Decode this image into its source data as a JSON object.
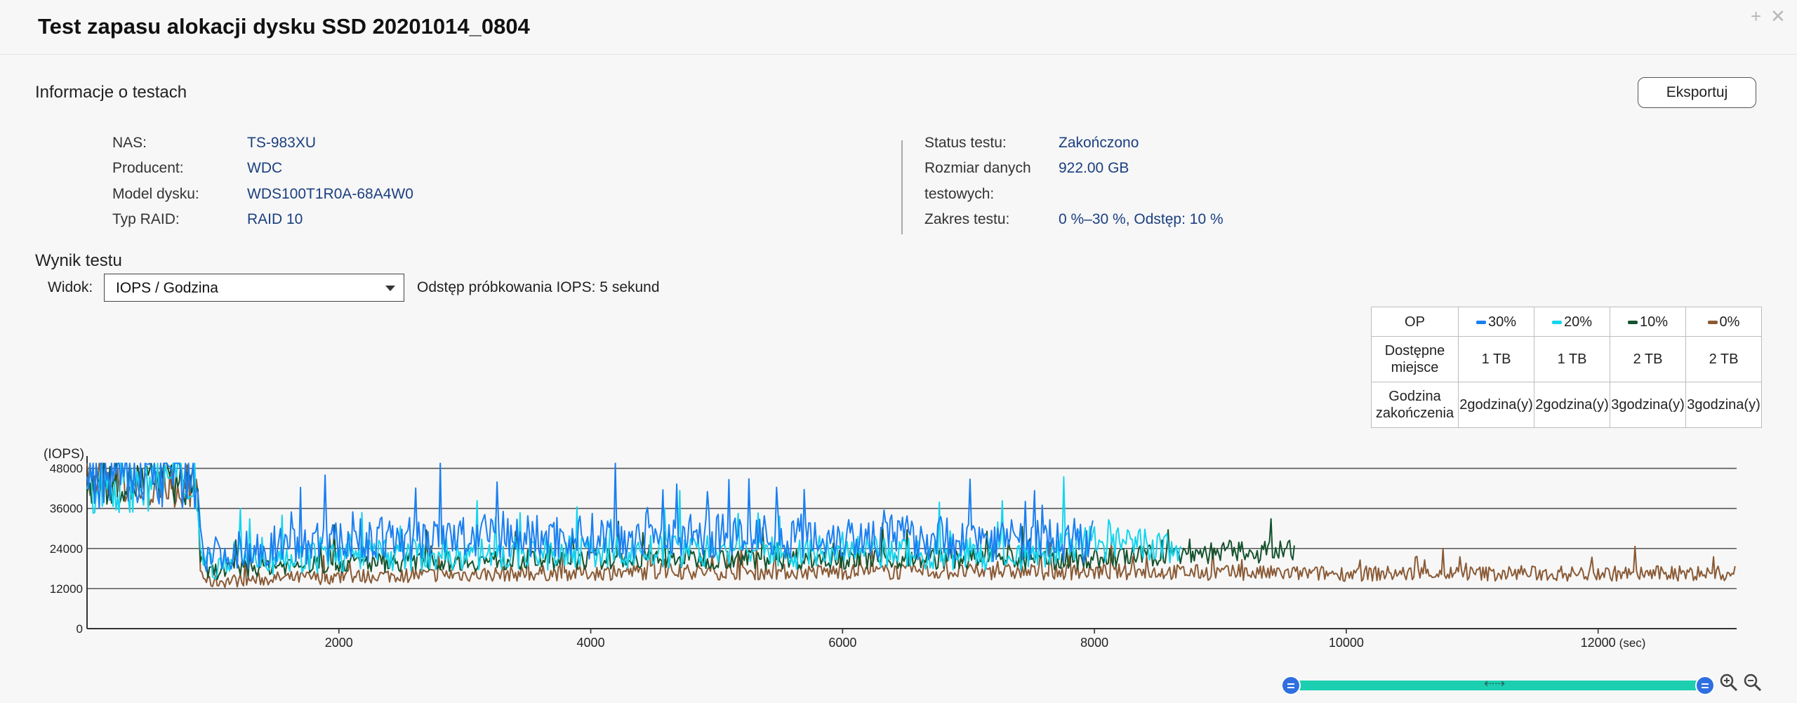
{
  "title": "Test zapasu alokacji dysku SSD 20201014_0804",
  "window_controls": {
    "pin": "+",
    "close": "✕"
  },
  "info_section_title": "Informacje o testach",
  "export_label": "Eksportuj",
  "info_left": [
    {
      "label": "NAS:",
      "value": "TS-983XU"
    },
    {
      "label": "Producent:",
      "value": "WDC"
    },
    {
      "label": "Model dysku:",
      "value": "WDS100T1R0A-68A4W0"
    },
    {
      "label": "Typ RAID:",
      "value": "RAID 10"
    }
  ],
  "info_right": {
    "status_label": "Status testu:",
    "status_value": "Zakończono",
    "size_label_line1": "Rozmiar danych",
    "size_label_line2": "testowych:",
    "size_value": "922.00 GB",
    "range_label": "Zakres testu:",
    "range_value": "0 %–30 %, Odstęp: 10 %"
  },
  "result_section_title": "Wynik testu",
  "view": {
    "label": "Widok:",
    "selected": "IOPS / Godzina"
  },
  "sampling_text": "Odstęp próbkowania IOPS: 5 sekund",
  "op_table": {
    "header": "OP",
    "columns": [
      {
        "label": "30%",
        "color": "#1a7ff0",
        "space": "1 TB",
        "time": "2godzina(y)"
      },
      {
        "label": "20%",
        "color": "#14d4ee",
        "space": "1 TB",
        "time": "2godzina(y)"
      },
      {
        "label": "10%",
        "color": "#14532d",
        "space": "2 TB",
        "time": "3godzina(y)"
      },
      {
        "label": "0%",
        "color": "#8a5a35",
        "space": "2 TB",
        "time": "3godzina(y)"
      }
    ],
    "row_space_label_1": "Dostępne",
    "row_space_label_2": "miejsce",
    "row_time_label_1": "Godzina",
    "row_time_label_2": "zakończenia"
  },
  "chart_data": {
    "type": "line",
    "ylabel": "(IOPS)",
    "xlabel": "(sec)",
    "ylim": [
      0,
      50000
    ],
    "xlim": [
      0,
      13100
    ],
    "yticks": [
      0,
      12000,
      24000,
      36000,
      48000
    ],
    "xticks": [
      2000,
      4000,
      6000,
      8000,
      10000,
      12000
    ],
    "grid": "horizontal",
    "series": [
      {
        "name": "30%",
        "color": "#1a7ff0",
        "x": [
          0,
          400,
          880,
          900,
          960,
          1500,
          2500,
          3500,
          4500,
          5500,
          6500,
          7500,
          7950,
          8000
        ],
        "y": [
          46000,
          47000,
          46500,
          26000,
          22000,
          25000,
          27000,
          27500,
          28000,
          28000,
          27500,
          26500,
          26000,
          26000
        ]
      },
      {
        "name": "20%",
        "color": "#14d4ee",
        "x": [
          0,
          400,
          880,
          900,
          960,
          1500,
          2500,
          3500,
          4500,
          5500,
          6500,
          7500,
          8000,
          8300,
          8600,
          8700
        ],
        "y": [
          44000,
          45000,
          44000,
          22000,
          19000,
          21000,
          22000,
          22500,
          23000,
          23000,
          22500,
          22000,
          26000,
          25000,
          24000,
          24000
        ]
      },
      {
        "name": "10%",
        "color": "#14532d",
        "x": [
          0,
          400,
          880,
          900,
          960,
          1500,
          2500,
          3500,
          4500,
          5500,
          6500,
          7500,
          8000,
          8500,
          9000,
          9500,
          9600
        ],
        "y": [
          43000,
          44000,
          43000,
          20000,
          17000,
          19000,
          20000,
          20500,
          21000,
          21000,
          21000,
          20500,
          21000,
          22000,
          23000,
          23000,
          23000
        ]
      },
      {
        "name": "0%",
        "color": "#8a5a35",
        "x": [
          0,
          400,
          880,
          900,
          960,
          1500,
          2500,
          3500,
          4500,
          5500,
          6500,
          7500,
          8500,
          9500,
          10500,
          11500,
          12500,
          13100
        ],
        "y": [
          42000,
          42000,
          42000,
          17000,
          14000,
          15000,
          16000,
          16500,
          17000,
          17000,
          17000,
          17000,
          17000,
          16500,
          16500,
          16500,
          16500,
          16500
        ]
      }
    ]
  }
}
